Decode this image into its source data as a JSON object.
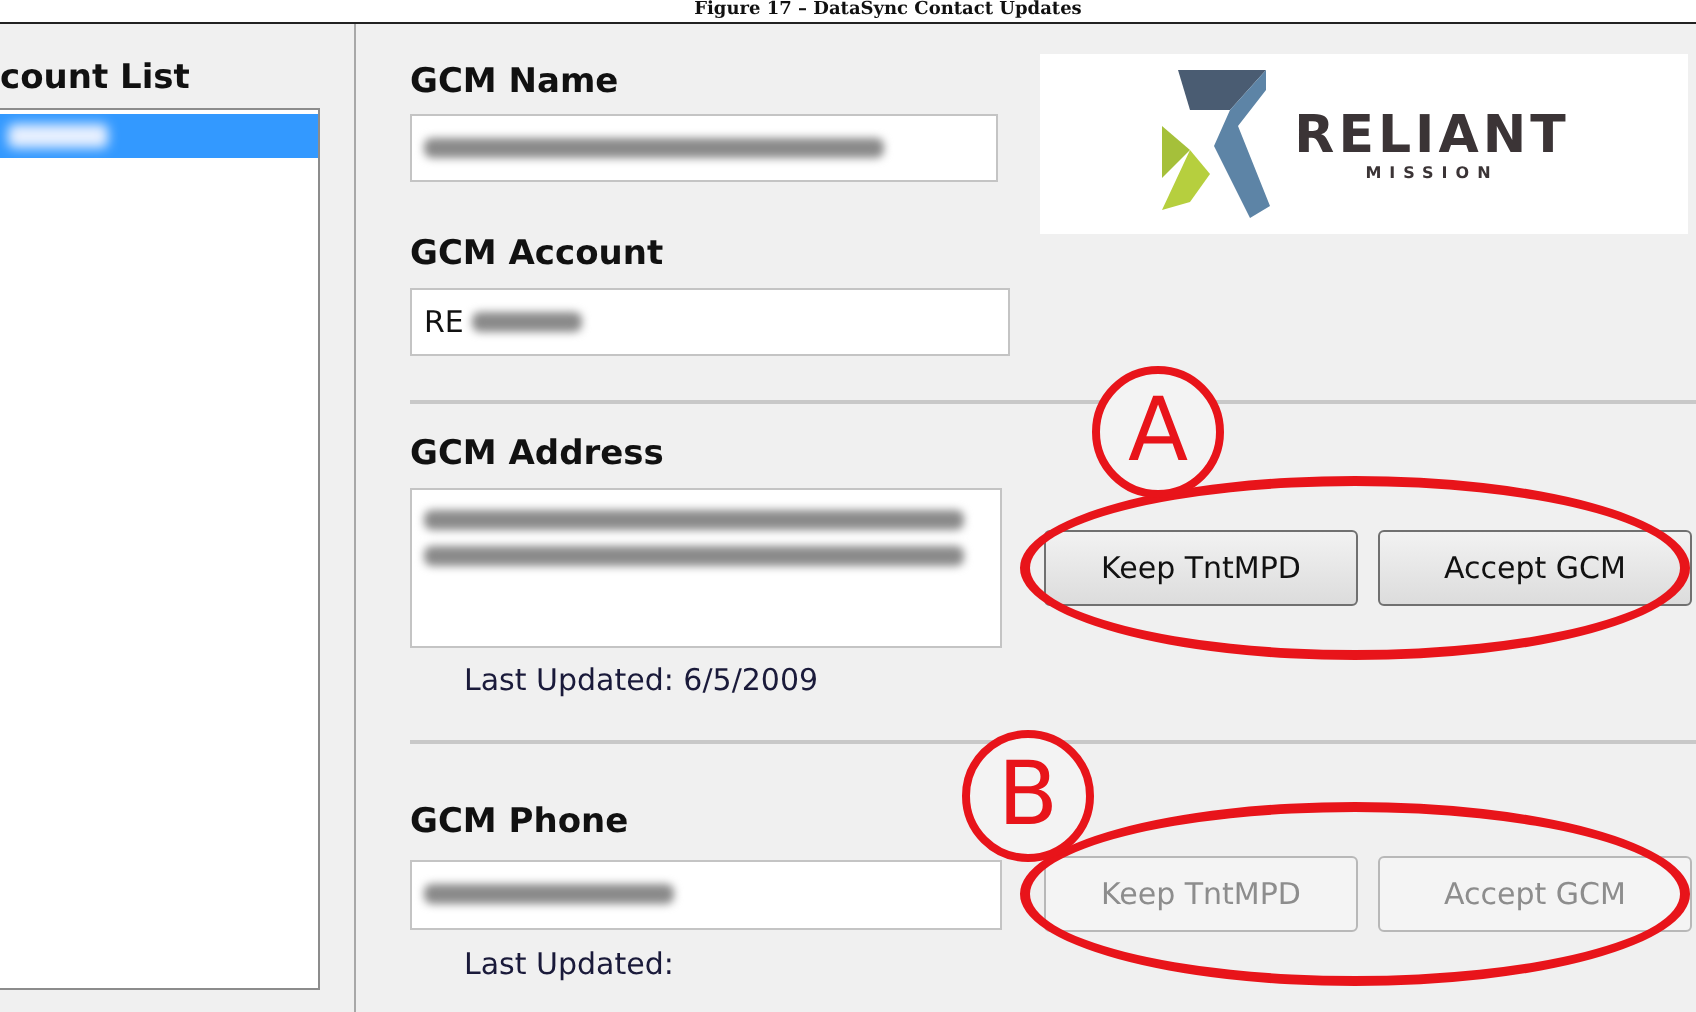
{
  "caption": "Figure 17 – DataSync Contact Updates",
  "account_list": {
    "title": "count List",
    "items": [
      {
        "selected": true,
        "redacted": true
      }
    ]
  },
  "top_fields": [
    {
      "label": "GCM Name",
      "redacted": true
    },
    {
      "label": "GCM Account",
      "value": "RE",
      "redacted": true
    }
  ],
  "logo": {
    "name": "RELIANT",
    "tagline": "MISSION"
  },
  "sections": [
    {
      "kind": "multiline",
      "label": "GCM Address",
      "redacted": true,
      "last_updated": "Last Updated: 6/5/2009",
      "annotation": "A",
      "buttons": [
        {
          "label": "Keep TntMPD",
          "disabled": false
        },
        {
          "label": "Accept GCM",
          "disabled": false
        }
      ]
    },
    {
      "kind": "line",
      "label": "GCM Phone",
      "redacted": true,
      "last_updated": "Last Updated:",
      "annotation": "B",
      "buttons": [
        {
          "label": "Keep TntMPD",
          "disabled": true
        },
        {
          "label": "Accept GCM",
          "disabled": true
        }
      ]
    }
  ]
}
